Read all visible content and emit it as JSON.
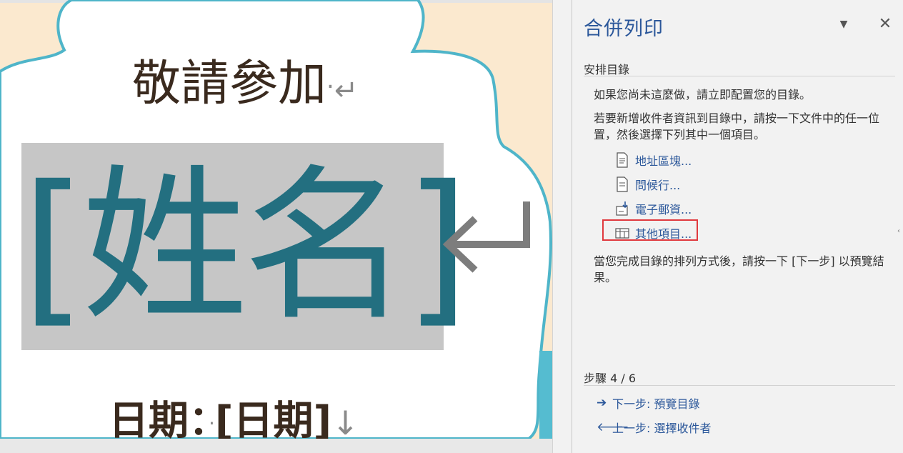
{
  "document": {
    "invite_text": "敬請參加",
    "paragraph_mark": "↵",
    "name_field": "[姓名]",
    "date_label": "日期：",
    "date_field": "[日期]",
    "date_arrow": "↓",
    "middle_dot": "·"
  },
  "pane": {
    "title": "合併列印",
    "dropdown_glyph": "▼",
    "close_glyph": "✕",
    "section_heading": "安排目錄",
    "intro": "如果您尚未這麼做，請立即配置您的目錄。",
    "instructions": "若要新增收件者資訊到目錄中，請按一下文件中的任一位置，然後選擇下列其中一個項目。",
    "items": [
      {
        "label": "地址區塊...",
        "icon": "address-block-icon"
      },
      {
        "label": "問候行...",
        "icon": "greeting-line-icon"
      },
      {
        "label": "電子郵資...",
        "icon": "electronic-postage-icon"
      },
      {
        "label": "其他項目...",
        "icon": "more-items-icon"
      }
    ],
    "completion_note": "當您完成目錄的排列方式後，請按一下 [下一步] 以預覽結果。",
    "step_label": "步驟 4 / 6",
    "next_step": "下一步: 預覽目錄",
    "prev_step": "上一步: 選擇收件者",
    "next_arrow": "➔",
    "prev_arrow": "🡐",
    "accent_color": "#2b579a",
    "highlight_color": "#e0393e"
  }
}
